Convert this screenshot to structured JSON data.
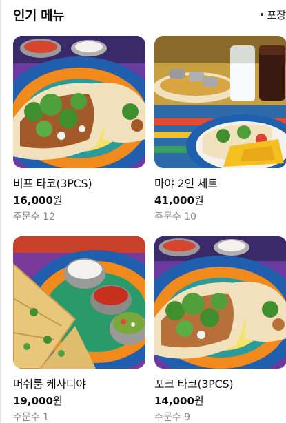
{
  "section": {
    "title": "인기 메뉴",
    "takeout_label": "포장"
  },
  "menu": [
    {
      "name": "비프 타코(3PCS)",
      "price": "16,000",
      "currency": "원",
      "orders": "주문수 12",
      "image": "beef-taco-photo"
    },
    {
      "name": "마야 2인 세트",
      "price": "41,000",
      "currency": "원",
      "orders": "주문수 10",
      "image": "maya-set-photo"
    },
    {
      "name": "머쉬룸 케사디야",
      "price": "19,000",
      "currency": "원",
      "orders": "주문수 1",
      "image": "mushroom-quesadilla-photo"
    },
    {
      "name": "포크 타코(3PCS)",
      "price": "14,000",
      "currency": "원",
      "orders": "주문수 9",
      "image": "pork-taco-photo"
    }
  ],
  "colors": {
    "text": "#111111",
    "muted": "#8a8a8a",
    "plate_blue": "#1f5fae",
    "plate_orange": "#f08a1c",
    "cilantro": "#3f8f2f",
    "tortilla": "#f1e2bd"
  }
}
